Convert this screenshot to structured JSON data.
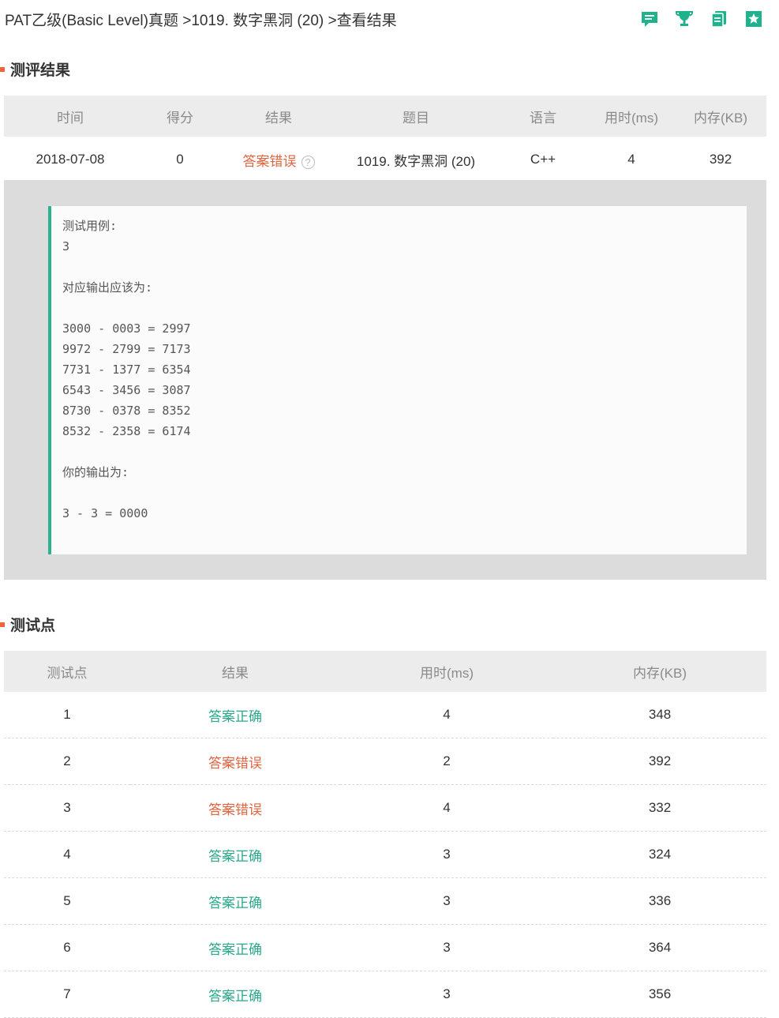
{
  "breadcrumb": {
    "part1": "PAT乙级(Basic Level)真题",
    "sep1": " >",
    "part2": "1019. 数字黑洞 (20)",
    "sep2": " >",
    "part3": "查看结果"
  },
  "toolbar_icons": [
    "comment-icon",
    "trophy-icon",
    "copy-icon",
    "star-bookmark-icon"
  ],
  "colors": {
    "accent_green": "#2aa88a",
    "error_red": "#e0643f",
    "section_mark": "#f0643c"
  },
  "result_section": {
    "title": "测评结果",
    "headers": [
      "时间",
      "得分",
      "结果",
      "题目",
      "语言",
      "用时(ms)",
      "内存(KB)"
    ],
    "row": {
      "time": "2018-07-08",
      "score": "0",
      "result": "答案错误",
      "help": "?",
      "problem": "1019. 数字黑洞 (20)",
      "language": "C++",
      "time_ms": "4",
      "memory_kb": "392"
    },
    "detail": "测试用例:\n3\n\n对应输出应该为:\n\n3000 - 0003 = 2997\n9972 - 2799 = 7173\n7731 - 1377 = 6354\n6543 - 3456 = 3087\n8730 - 0378 = 8352\n8532 - 2358 = 6174\n\n你的输出为:\n\n3 - 3 = 0000"
  },
  "testcase_section": {
    "title": "测试点",
    "headers": [
      "测试点",
      "结果",
      "用时(ms)",
      "内存(KB)"
    ],
    "rows": [
      {
        "id": "1",
        "result": "答案正确",
        "status": "ok",
        "time_ms": "4",
        "memory_kb": "348"
      },
      {
        "id": "2",
        "result": "答案错误",
        "status": "wrong",
        "time_ms": "2",
        "memory_kb": "392"
      },
      {
        "id": "3",
        "result": "答案错误",
        "status": "wrong",
        "time_ms": "4",
        "memory_kb": "332"
      },
      {
        "id": "4",
        "result": "答案正确",
        "status": "ok",
        "time_ms": "3",
        "memory_kb": "324"
      },
      {
        "id": "5",
        "result": "答案正确",
        "status": "ok",
        "time_ms": "3",
        "memory_kb": "336"
      },
      {
        "id": "6",
        "result": "答案正确",
        "status": "ok",
        "time_ms": "3",
        "memory_kb": "364"
      },
      {
        "id": "7",
        "result": "答案正确",
        "status": "ok",
        "time_ms": "3",
        "memory_kb": "356"
      }
    ]
  }
}
